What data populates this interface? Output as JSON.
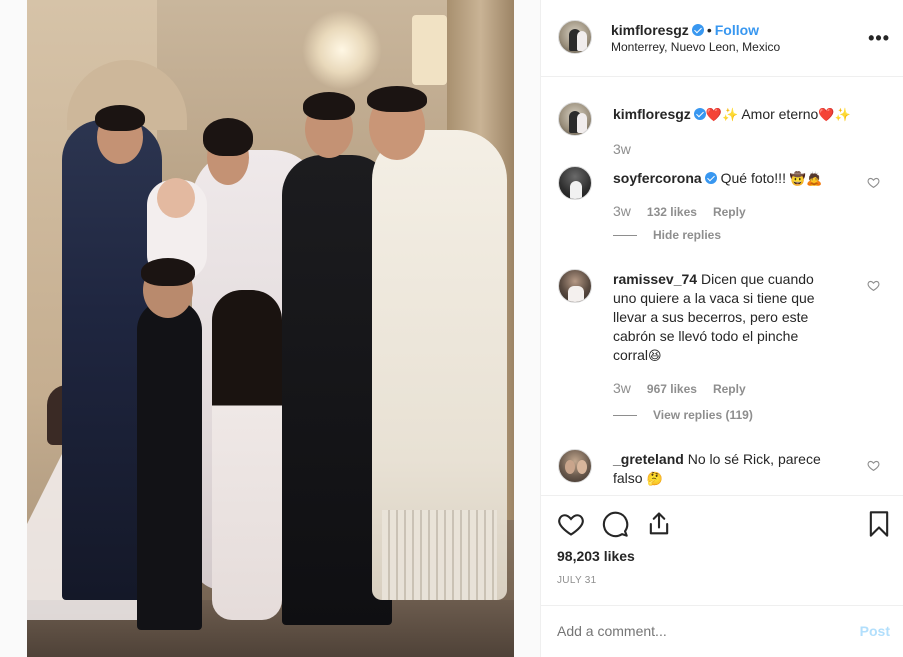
{
  "post": {
    "username": "kimfloresgz",
    "location": "Monterrey, Nuevo Leon, Mexico",
    "follow_label": "Follow",
    "dot": "•",
    "more": "•••",
    "caption_text": "Amor eterno",
    "caption_emoji_before": "❤️✨",
    "caption_emoji_after": "❤️✨",
    "caption_time": "3w",
    "likes": "98,203 likes",
    "date": "JULY 31"
  },
  "comments": [
    {
      "username": "soyfercorona",
      "verified": true,
      "text": "Qué foto!!!",
      "emoji": "🤠🙇",
      "time": "3w",
      "likes": "132 likes",
      "reply": "Reply",
      "replies_toggle": "Hide replies"
    },
    {
      "username": "ramissev_74",
      "text_lines": [
        "Dicen que cuando",
        "uno quiere a la vaca si tiene que",
        "llevar a sus becerros, pero este",
        "cabrón se llevó todo el pinche",
        "corral"
      ],
      "emoji": "😆",
      "time": "3w",
      "likes": "967 likes",
      "reply": "Reply",
      "replies_toggle": "View replies (119)"
    },
    {
      "username": "_greteland",
      "text_lines": [
        "No lo sé Rick, parece",
        "falso"
      ],
      "emoji": "🤔"
    }
  ],
  "add_comment": {
    "placeholder": "Add a comment...",
    "post_label": "Post"
  },
  "colors": {
    "accent": "#3897f0",
    "muted": "#8e8e8e",
    "post_disabled": "#b2dffc"
  }
}
